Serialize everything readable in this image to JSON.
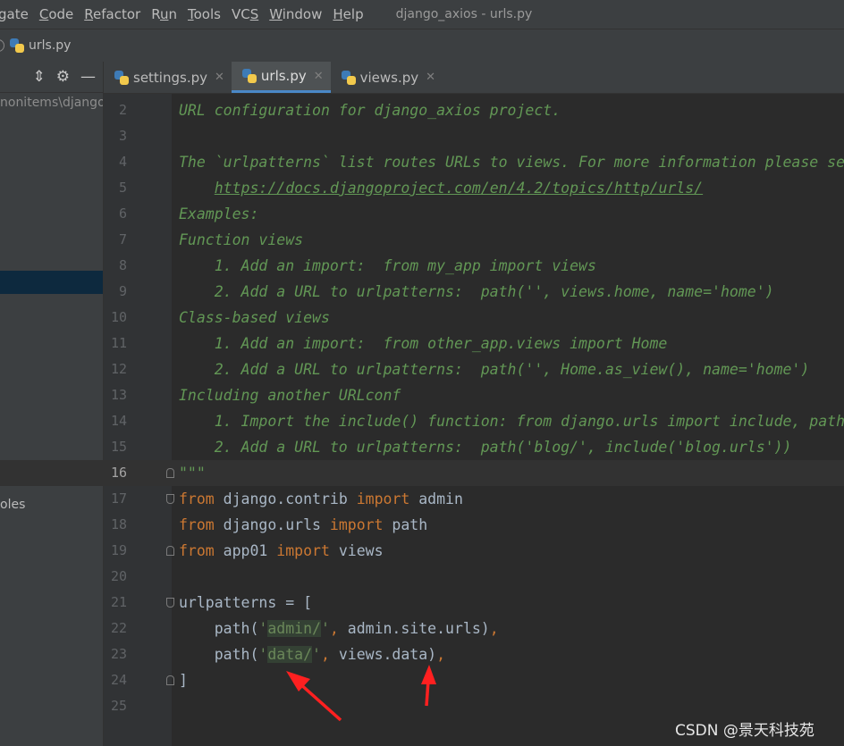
{
  "window_title": "django_axios - urls.py",
  "menu": [
    {
      "pre": "",
      "u": "",
      "post": "gate"
    },
    {
      "pre": "",
      "u": "C",
      "post": "ode"
    },
    {
      "pre": "",
      "u": "R",
      "post": "efactor"
    },
    {
      "pre": "R",
      "u": "u",
      "post": "n"
    },
    {
      "pre": "",
      "u": "T",
      "post": "ools"
    },
    {
      "pre": "VC",
      "u": "S",
      "post": ""
    },
    {
      "pre": "",
      "u": "W",
      "post": "indow"
    },
    {
      "pre": "",
      "u": "H",
      "post": "elp"
    }
  ],
  "breadcrumb": {
    "file": "urls.py"
  },
  "project_panel": {
    "path_text": "nonitems\\django_",
    "item_text": "oles"
  },
  "tabs": [
    {
      "label": "settings.py",
      "active": false
    },
    {
      "label": "urls.py",
      "active": true
    },
    {
      "label": "views.py",
      "active": false
    }
  ],
  "close_glyph": "✕",
  "editor": {
    "current_line": 16,
    "lines": [
      {
        "n": "2",
        "segs": [
          {
            "t": "URL configuration for django_axios project.",
            "c": "doc"
          }
        ]
      },
      {
        "n": "3",
        "segs": []
      },
      {
        "n": "4",
        "segs": [
          {
            "t": "The `urlpatterns` list routes URLs to views. For more information please see:",
            "c": "doc"
          }
        ]
      },
      {
        "n": "5",
        "segs": [
          {
            "t": "    ",
            "c": "doc"
          },
          {
            "t": "https://docs.djangoproject.com/en/4.2/topics/http/urls/",
            "c": "doclink"
          }
        ]
      },
      {
        "n": "6",
        "segs": [
          {
            "t": "Examples:",
            "c": "doc"
          }
        ]
      },
      {
        "n": "7",
        "segs": [
          {
            "t": "Function views",
            "c": "doc"
          }
        ]
      },
      {
        "n": "8",
        "segs": [
          {
            "t": "    1. Add an import:  from my_app import views",
            "c": "doc"
          }
        ]
      },
      {
        "n": "9",
        "segs": [
          {
            "t": "    2. Add a URL to urlpatterns:  path('', views.home, name='home')",
            "c": "doc"
          }
        ]
      },
      {
        "n": "10",
        "segs": [
          {
            "t": "Class-based views",
            "c": "doc"
          }
        ]
      },
      {
        "n": "11",
        "segs": [
          {
            "t": "    1. Add an import:  from other_app.views import Home",
            "c": "doc"
          }
        ]
      },
      {
        "n": "12",
        "segs": [
          {
            "t": "    2. Add a URL to urlpatterns:  path('', Home.as_view(), name='home')",
            "c": "doc"
          }
        ]
      },
      {
        "n": "13",
        "segs": [
          {
            "t": "Including another URLconf",
            "c": "doc"
          }
        ]
      },
      {
        "n": "14",
        "segs": [
          {
            "t": "    1. Import the include() function: from django.urls import include, path",
            "c": "doc"
          }
        ]
      },
      {
        "n": "15",
        "segs": [
          {
            "t": "    2. Add a URL to urlpatterns:  path('blog/', include('blog.urls'))",
            "c": "doc"
          }
        ]
      },
      {
        "n": "16",
        "fold": "end",
        "segs": [
          {
            "t": "\"\"\"",
            "c": "doc"
          }
        ]
      },
      {
        "n": "17",
        "fold": "start",
        "segs": [
          {
            "t": "from",
            "c": "kw"
          },
          {
            "t": " django.contrib ",
            "c": ""
          },
          {
            "t": "import",
            "c": "kw"
          },
          {
            "t": " admin",
            "c": ""
          }
        ]
      },
      {
        "n": "18",
        "segs": [
          {
            "t": "from",
            "c": "kw"
          },
          {
            "t": " django.urls ",
            "c": ""
          },
          {
            "t": "import",
            "c": "kw"
          },
          {
            "t": " path",
            "c": ""
          }
        ]
      },
      {
        "n": "19",
        "fold": "end",
        "segs": [
          {
            "t": "from",
            "c": "kw"
          },
          {
            "t": " app01 ",
            "c": ""
          },
          {
            "t": "import",
            "c": "kw"
          },
          {
            "t": " views",
            "c": ""
          }
        ]
      },
      {
        "n": "20",
        "segs": []
      },
      {
        "n": "21",
        "fold": "start",
        "segs": [
          {
            "t": "urlpatterns = [",
            "c": ""
          }
        ]
      },
      {
        "n": "22",
        "segs": [
          {
            "t": "    path(",
            "c": ""
          },
          {
            "t": "'",
            "c": "str"
          },
          {
            "t": "admin/",
            "c": "strhl"
          },
          {
            "t": "'",
            "c": "str"
          },
          {
            "t": ", ",
            "c": "punc"
          },
          {
            "t": "admin.site.urls)",
            "c": ""
          },
          {
            "t": ",",
            "c": "punc"
          }
        ]
      },
      {
        "n": "23",
        "segs": [
          {
            "t": "    path(",
            "c": ""
          },
          {
            "t": "'",
            "c": "str"
          },
          {
            "t": "data/",
            "c": "strhl"
          },
          {
            "t": "'",
            "c": "str"
          },
          {
            "t": ", ",
            "c": "punc"
          },
          {
            "t": "views.data)",
            "c": ""
          },
          {
            "t": ",",
            "c": "punc"
          }
        ]
      },
      {
        "n": "24",
        "fold": "end",
        "segs": [
          {
            "t": "]",
            "c": ""
          }
        ]
      },
      {
        "n": "25",
        "segs": []
      }
    ]
  },
  "annotation_color": "#ff2020",
  "watermark": "CSDN @景天科技苑"
}
